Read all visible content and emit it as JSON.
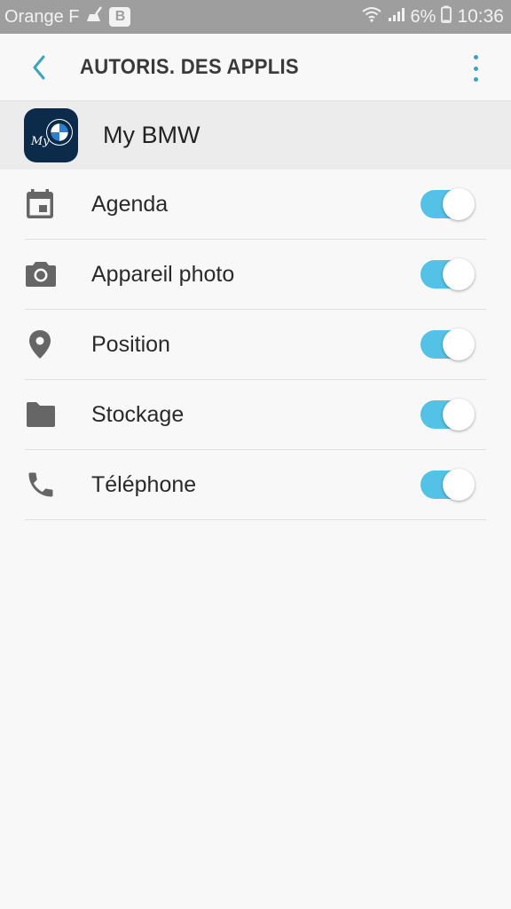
{
  "status_bar": {
    "carrier": "Orange F",
    "b_badge": "B",
    "battery_percent": "6%",
    "time": "10:36"
  },
  "header": {
    "title": "AUTORIS. DES APPLIS",
    "back_icon": "chevron-left-icon",
    "more_icon": "more-vert-icon",
    "accent_color": "#3aa5b8"
  },
  "app": {
    "name": "My BMW",
    "icon": "bmw-app-icon",
    "icon_text": "My"
  },
  "permissions": [
    {
      "label": "Agenda",
      "icon": "calendar-icon",
      "enabled": true
    },
    {
      "label": "Appareil photo",
      "icon": "camera-icon",
      "enabled": true
    },
    {
      "label": "Position",
      "icon": "location-pin-icon",
      "enabled": true
    },
    {
      "label": "Stockage",
      "icon": "folder-icon",
      "enabled": true
    },
    {
      "label": "Téléphone",
      "icon": "phone-icon",
      "enabled": true
    }
  ],
  "colors": {
    "toggle_on": "#54c1e6",
    "status_bar_bg": "#9e9e9e",
    "app_icon_bg": "#0c2b4b"
  }
}
